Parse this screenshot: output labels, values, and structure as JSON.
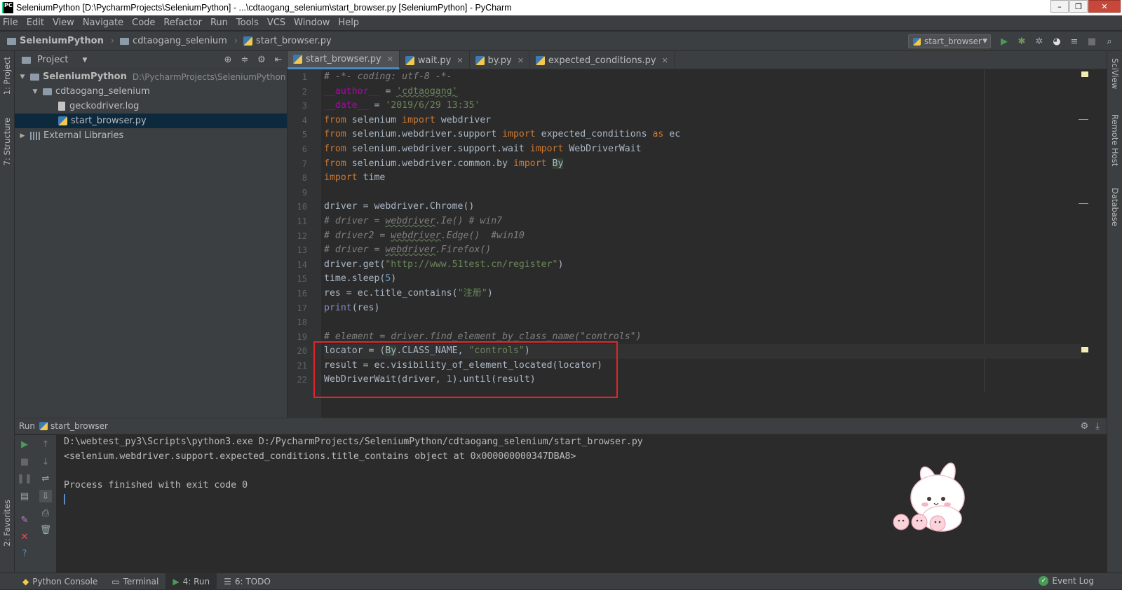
{
  "window": {
    "title": "SeleniumPython [D:\\PycharmProjects\\SeleniumPython] - ...\\cdtaogang_selenium\\start_browser.py [SeleniumPython] - PyCharm"
  },
  "menu": [
    "File",
    "Edit",
    "View",
    "Navigate",
    "Code",
    "Refactor",
    "Run",
    "Tools",
    "VCS",
    "Window",
    "Help"
  ],
  "breadcrumb": [
    "SeleniumPython",
    "cdtaogang_selenium",
    "start_browser.py"
  ],
  "run_config": "start_browser",
  "left_strip": {
    "project": "1: Project",
    "structure": "7: Structure",
    "favorites": "2: Favorites"
  },
  "right_strip": {
    "sciview": "SciView",
    "remote_host": "Remote Host",
    "database": "Database"
  },
  "project_panel": {
    "title": "Project",
    "tree": [
      {
        "name": "SeleniumPython",
        "path": "D:\\PycharmProjects\\SeleniumPython"
      },
      {
        "name": "cdtaogang_selenium"
      },
      {
        "name": "geckodriver.log"
      },
      {
        "name": "start_browser.py"
      },
      {
        "name": "External Libraries"
      }
    ]
  },
  "editor_tabs": [
    "start_browser.py",
    "wait.py",
    "by.py",
    "expected_conditions.py"
  ],
  "line_numbers": [
    "1",
    "2",
    "3",
    "4",
    "5",
    "6",
    "7",
    "8",
    "9",
    "10",
    "11",
    "12",
    "13",
    "14",
    "15",
    "16",
    "17",
    "18",
    "19",
    "20",
    "21",
    "22"
  ],
  "code": {
    "l1": "# -*- coding: utf-8 -*-",
    "l2_a": "__author__",
    "l2_b": " = ",
    "l2_c": "'cdtaogang'",
    "l3_a": "__date__",
    "l3_b": " = ",
    "l3_c": "'2019/6/29 13:35'",
    "l4_a": "from",
    "l4_b": " selenium ",
    "l4_c": "import",
    "l4_d": " webdriver",
    "l5_a": "from",
    "l5_b": " selenium.webdriver.support ",
    "l5_c": "import",
    "l5_d": " expected_conditions ",
    "l5_e": "as",
    "l5_f": " ec",
    "l6_a": "from",
    "l6_b": " selenium.webdriver.support.wait ",
    "l6_c": "import",
    "l6_d": " WebDriverWait",
    "l7_a": "from",
    "l7_b": " selenium.webdriver.common.by ",
    "l7_c": "import",
    "l7_d": " ",
    "l7_e": "By",
    "l8_a": "import",
    "l8_b": " time",
    "l10": "driver = webdriver.Chrome()",
    "l11_a": "# driver = ",
    "l11_b": "webdriver",
    "l11_c": ".Ie() # win7",
    "l12_a": "# driver2 = ",
    "l12_b": "webdriver",
    "l12_c": ".Edge()  #win10",
    "l13_a": "# driver = ",
    "l13_b": "webdriver",
    "l13_c": ".Firefox()",
    "l14_a": "driver.get(",
    "l14_b": "\"http://www.51test.cn/register\"",
    "l14_c": ")",
    "l15_a": "time.sleep(",
    "l15_b": "5",
    "l15_c": ")",
    "l16_a": "res = ec.title_contains(",
    "l16_b": "\"注册\"",
    "l16_c": ")",
    "l17_a": "print",
    "l17_b": "(res)",
    "l19": "# element = driver.find_element_by_class_name(\"controls\")",
    "l20_a": "locator = (",
    "l20_b": "By",
    "l20_c": ".CLASS_NAME, ",
    "l20_d": "\"controls\"",
    "l20_e": ")",
    "l21": "result = ec.visibility_of_element_located(locator)",
    "l22_a": "WebDriverWait(driver, ",
    "l22_b": "1",
    "l22_c": ").until(result)"
  },
  "run_panel": {
    "label": "Run",
    "config": "start_browser",
    "output": [
      "D:\\webtest_py3\\Scripts\\python3.exe D:/PycharmProjects/SeleniumPython/cdtaogang_selenium/start_browser.py",
      "<selenium.webdriver.support.expected_conditions.title_contains object at 0x000000000347DBA8>",
      "",
      "Process finished with exit code 0"
    ]
  },
  "bottom_tabs": [
    "Python Console",
    "Terminal",
    "4: Run",
    "6: TODO"
  ],
  "event_log": "Event Log",
  "colors": {
    "highlight_box": "#e0252b",
    "run_green": "#499c54",
    "tab_underline": "#4a88c7"
  },
  "icons": [
    "pycharm-logo-icon",
    "folder-icon",
    "python-file-icon",
    "run-icon",
    "debug-icon",
    "coverage-icon",
    "profile-icon",
    "stop-icon",
    "search-icon",
    "gear-icon",
    "bunny-sticker"
  ]
}
